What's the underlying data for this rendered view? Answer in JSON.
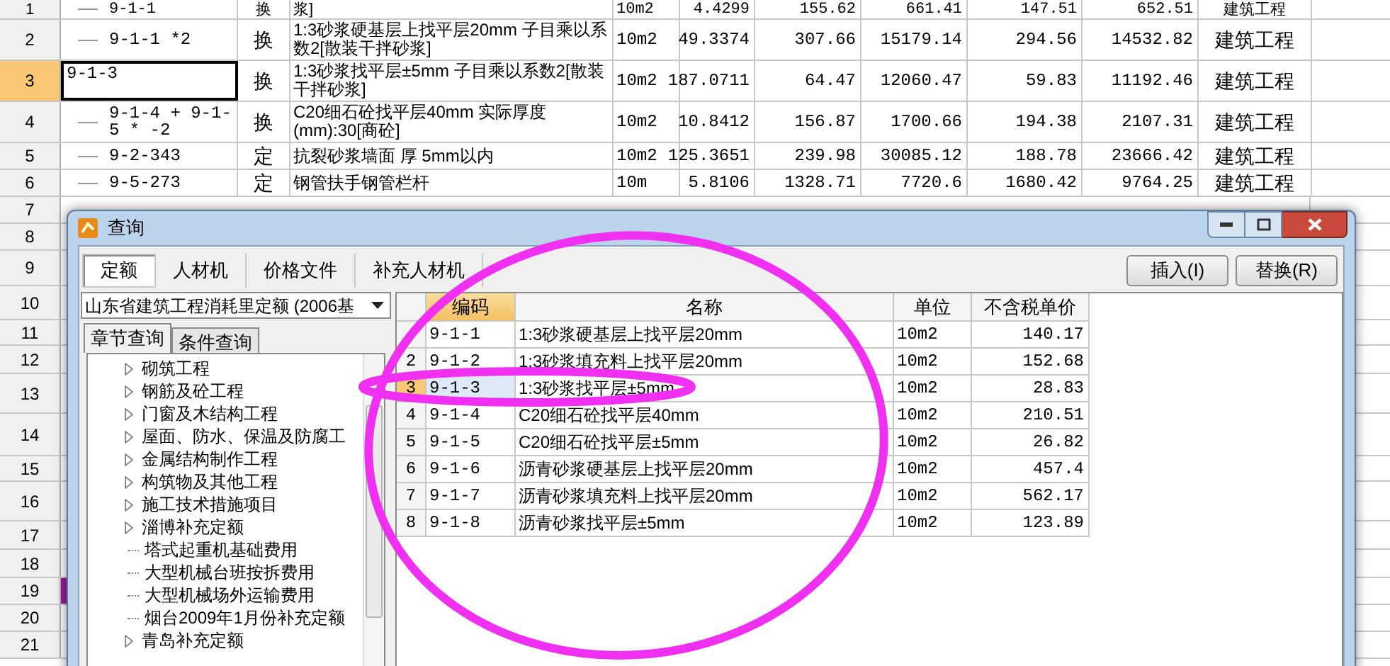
{
  "sheet": {
    "rows": [
      {
        "number": "1",
        "code": "9-1-1",
        "type": "换",
        "name": "浆]",
        "unit": "10m2",
        "quantity": "4.4299",
        "unit_price": "155.62",
        "amount": "661.41",
        "column_9": "147.51",
        "column_10": "652.51",
        "category": "建筑工程",
        "selected": false,
        "marked": false
      },
      {
        "number": "2",
        "code": "9-1-1 *2",
        "type": "换",
        "name": "1:3砂浆硬基层上找平层20mm 子目乘以系数2[散装干拌砂浆]",
        "unit": "10m2",
        "quantity": "49.3374",
        "unit_price": "307.66",
        "amount": "15179.14",
        "column_9": "294.56",
        "column_10": "14532.82",
        "category": "建筑工程",
        "selected": false,
        "marked": false
      },
      {
        "number": "3",
        "code": "9-1-3",
        "type": "换",
        "name": "1:3砂浆找平层±5mm 子目乘以系数2[散装干拌砂浆]",
        "unit": "10m2",
        "quantity": "187.0711",
        "unit_price": "64.47",
        "amount": "12060.47",
        "column_9": "59.83",
        "column_10": "11192.46",
        "category": "建筑工程",
        "selected": true,
        "marked": false
      },
      {
        "number": "4",
        "code": "9-1-4 + 9-1-5 * -2",
        "type": "换",
        "name": "C20细石砼找平层40mm 实际厚度(mm):30[商砼]",
        "unit": "10m2",
        "quantity": "10.8412",
        "unit_price": "156.87",
        "amount": "1700.66",
        "column_9": "194.38",
        "column_10": "2107.31",
        "category": "建筑工程",
        "selected": false,
        "marked": false
      },
      {
        "number": "5",
        "code": "9-2-343",
        "type": "定",
        "name": "抗裂砂浆墙面 厚 5mm以内",
        "unit": "10m2",
        "quantity": "125.3651",
        "unit_price": "239.98",
        "amount": "30085.12",
        "column_9": "188.78",
        "column_10": "23666.42",
        "category": "建筑工程",
        "selected": false,
        "marked": false
      },
      {
        "number": "6",
        "code": "9-5-273",
        "type": "定",
        "name": "钢管扶手钢管栏杆",
        "unit": "10m",
        "quantity": "5.8106",
        "unit_price": "1328.71",
        "amount": "7720.6",
        "column_9": "1680.42",
        "column_10": "9764.25",
        "category": "建筑工程",
        "selected": false,
        "marked": false
      },
      {
        "number": "7",
        "selected": false,
        "marked": false
      },
      {
        "number": "8",
        "selected": false,
        "marked": false
      },
      {
        "number": "9",
        "selected": false,
        "marked": false
      },
      {
        "number": "10",
        "selected": false,
        "marked": false
      },
      {
        "number": "11",
        "selected": false,
        "marked": false
      },
      {
        "number": "12",
        "selected": false,
        "marked": false
      },
      {
        "number": "13",
        "selected": false,
        "marked": false
      },
      {
        "number": "14",
        "selected": false,
        "marked": false
      },
      {
        "number": "15",
        "selected": false,
        "marked": false
      },
      {
        "number": "16",
        "selected": false,
        "marked": false
      },
      {
        "number": "17",
        "selected": false,
        "marked": false
      },
      {
        "number": "18",
        "selected": false,
        "marked": false
      },
      {
        "number": "19",
        "selected": false,
        "marked": true
      },
      {
        "number": "20",
        "selected": false,
        "marked": false
      },
      {
        "number": "21",
        "selected": false,
        "marked": false
      }
    ]
  },
  "dialog": {
    "title": "查询",
    "tabs": [
      {
        "label": "定额",
        "selected": true
      },
      {
        "label": "人材机",
        "selected": false
      },
      {
        "label": "价格文件",
        "selected": false
      },
      {
        "label": "补充人材机",
        "selected": false
      }
    ],
    "buttons": [
      "插入(I)",
      "替换(R)"
    ],
    "quota_library": "山东省建筑工程消耗里定额 (2006基",
    "sub_tabs": [
      {
        "label": "章节查询",
        "selected": true
      },
      {
        "label": "条件查询",
        "selected": false
      }
    ],
    "chapters": [
      {
        "label": "砌筑工程",
        "expandable": true
      },
      {
        "label": "钢筋及砼工程",
        "expandable": true
      },
      {
        "label": "门窗及木结构工程",
        "expandable": true
      },
      {
        "label": "屋面、防水、保温及防腐工",
        "expandable": true
      },
      {
        "label": "金属结构制作工程",
        "expandable": true
      },
      {
        "label": "构筑物及其他工程",
        "expandable": true
      },
      {
        "label": "施工技术措施项目",
        "expandable": true
      },
      {
        "label": "淄博补充定额",
        "expandable": true
      },
      {
        "label": "塔式起重机基础费用",
        "expandable": false
      },
      {
        "label": "大型机械台班按拆费用",
        "expandable": false
      },
      {
        "label": "大型机械场外运输费用",
        "expandable": false
      },
      {
        "label": "烟台2009年1月份补充定额",
        "expandable": false
      },
      {
        "label": "青岛补充定额",
        "expandable": true
      }
    ],
    "table": {
      "columns": [
        "编码",
        "名称",
        "单位",
        "不含税单价"
      ],
      "rows": [
        {
          "code": "9-1-1",
          "name": "1:3砂浆硬基层上找平层20mm",
          "unit": "10m2",
          "price": "140.17",
          "selected": false
        },
        {
          "number": "2",
          "code": "9-1-2",
          "name": "1:3砂浆填充料上找平层20mm",
          "unit": "10m2",
          "price": "152.68",
          "selected": false
        },
        {
          "number": "3",
          "code": "9-1-3",
          "name": "1:3砂浆找平层±5mm",
          "unit": "10m2",
          "price": "28.83",
          "selected": true
        },
        {
          "number": "4",
          "code": "9-1-4",
          "name": "C20细石砼找平层40mm",
          "unit": "10m2",
          "price": "210.51",
          "selected": false
        },
        {
          "number": "5",
          "code": "9-1-5",
          "name": "C20细石砼找平层±5mm",
          "unit": "10m2",
          "price": "26.82",
          "selected": false
        },
        {
          "number": "6",
          "code": "9-1-6",
          "name": "沥青砂浆硬基层上找平层20mm",
          "unit": "10m2",
          "price": "457.4",
          "selected": false
        },
        {
          "number": "7",
          "code": "9-1-7",
          "name": "沥青砂浆填充料上找平层20mm",
          "unit": "10m2",
          "price": "562.17",
          "selected": false
        },
        {
          "number": "8",
          "code": "9-1-8",
          "name": "沥青砂浆找平层±5mm",
          "unit": "10m2",
          "price": "123.89",
          "selected": false
        }
      ]
    }
  },
  "markup": [
    {
      "kind": "ellipse"
    },
    {
      "kind": "ellipse"
    }
  ]
}
